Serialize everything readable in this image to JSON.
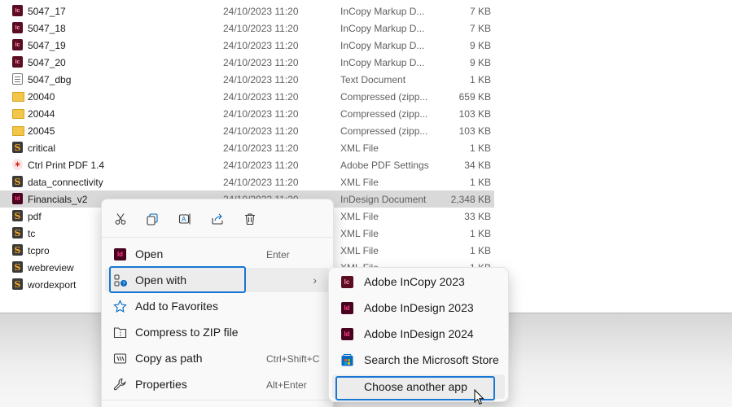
{
  "files": [
    {
      "name": "5047_17",
      "date": "24/10/2023 11:20",
      "type": "InCopy Markup D...",
      "size": "7 KB",
      "icon": "incopy-icon"
    },
    {
      "name": "5047_18",
      "date": "24/10/2023 11:20",
      "type": "InCopy Markup D...",
      "size": "7 KB",
      "icon": "incopy-icon"
    },
    {
      "name": "5047_19",
      "date": "24/10/2023 11:20",
      "type": "InCopy Markup D...",
      "size": "9 KB",
      "icon": "incopy-icon"
    },
    {
      "name": "5047_20",
      "date": "24/10/2023 11:20",
      "type": "InCopy Markup D...",
      "size": "9 KB",
      "icon": "incopy-icon"
    },
    {
      "name": "5047_dbg",
      "date": "24/10/2023 11:20",
      "type": "Text Document",
      "size": "1 KB",
      "icon": "text-document-icon"
    },
    {
      "name": "20040",
      "date": "24/10/2023 11:20",
      "type": "Compressed (zipp...",
      "size": "659 KB",
      "icon": "zip-folder-icon"
    },
    {
      "name": "20044",
      "date": "24/10/2023 11:20",
      "type": "Compressed (zipp...",
      "size": "103 KB",
      "icon": "zip-folder-icon"
    },
    {
      "name": "20045",
      "date": "24/10/2023 11:20",
      "type": "Compressed (zipp...",
      "size": "103 KB",
      "icon": "zip-folder-icon"
    },
    {
      "name": "critical",
      "date": "24/10/2023 11:20",
      "type": "XML File",
      "size": "1 KB",
      "icon": "xml-icon"
    },
    {
      "name": "Ctrl Print PDF 1.4",
      "date": "24/10/2023 11:20",
      "type": "Adobe PDF Settings",
      "size": "34 KB",
      "icon": "pdf-settings-icon"
    },
    {
      "name": "data_connectivity",
      "date": "24/10/2023 11:20",
      "type": "XML File",
      "size": "1 KB",
      "icon": "xml-icon"
    },
    {
      "name": "Financials_v2",
      "date": "24/10/2023 11:20",
      "type": "InDesign Document",
      "size": "2,348 KB",
      "icon": "indesign-icon",
      "selected": true
    },
    {
      "name": "pdf",
      "date": "",
      "type": "XML File",
      "size": "33 KB",
      "icon": "xml-icon"
    },
    {
      "name": "tc",
      "date": "",
      "type": "XML File",
      "size": "1 KB",
      "icon": "xml-icon"
    },
    {
      "name": "tcpro",
      "date": "",
      "type": "XML File",
      "size": "1 KB",
      "icon": "xml-icon"
    },
    {
      "name": "webreview",
      "date": "",
      "type": "XML File",
      "size": "1 KB",
      "icon": "xml-icon"
    },
    {
      "name": "wordexport",
      "date": "",
      "type": "",
      "size": "",
      "icon": "xml-icon"
    }
  ],
  "context_menu": {
    "quick_actions": [
      "cut-icon",
      "copy-icon",
      "rename-icon",
      "share-icon",
      "delete-icon"
    ],
    "items": [
      {
        "label": "Open",
        "shortcut": "Enter",
        "icon": "indesign-icon"
      },
      {
        "label": "Open with",
        "shortcut": "",
        "icon": "open-with-icon",
        "submenu": true
      },
      {
        "label": "Add to Favorites",
        "shortcut": "",
        "icon": "star-icon"
      },
      {
        "label": "Compress to ZIP file",
        "shortcut": "",
        "icon": "zip-icon"
      },
      {
        "label": "Copy as path",
        "shortcut": "Ctrl+Shift+C",
        "icon": "copy-path-icon"
      },
      {
        "label": "Properties",
        "shortcut": "Alt+Enter",
        "icon": "wrench-icon"
      }
    ]
  },
  "open_with_submenu": {
    "items": [
      {
        "label": "Adobe InCopy 2023",
        "icon": "incopy-icon",
        "color": "#5b0d22",
        "glyph": "Ic"
      },
      {
        "label": "Adobe InDesign 2023",
        "icon": "indesign-icon",
        "color": "#49021f",
        "glyph": "Id"
      },
      {
        "label": "Adobe InDesign 2024",
        "icon": "indesign-icon",
        "color": "#49021f",
        "glyph": "Id"
      },
      {
        "label": "Search the Microsoft Store",
        "icon": "microsoft-store-icon",
        "color": "#0078d4",
        "glyph": ""
      },
      {
        "label": "Choose another app",
        "icon": "",
        "color": "",
        "glyph": ""
      }
    ]
  },
  "colors": {
    "highlight": "#1976d2",
    "selection": "#d9d9d9"
  }
}
